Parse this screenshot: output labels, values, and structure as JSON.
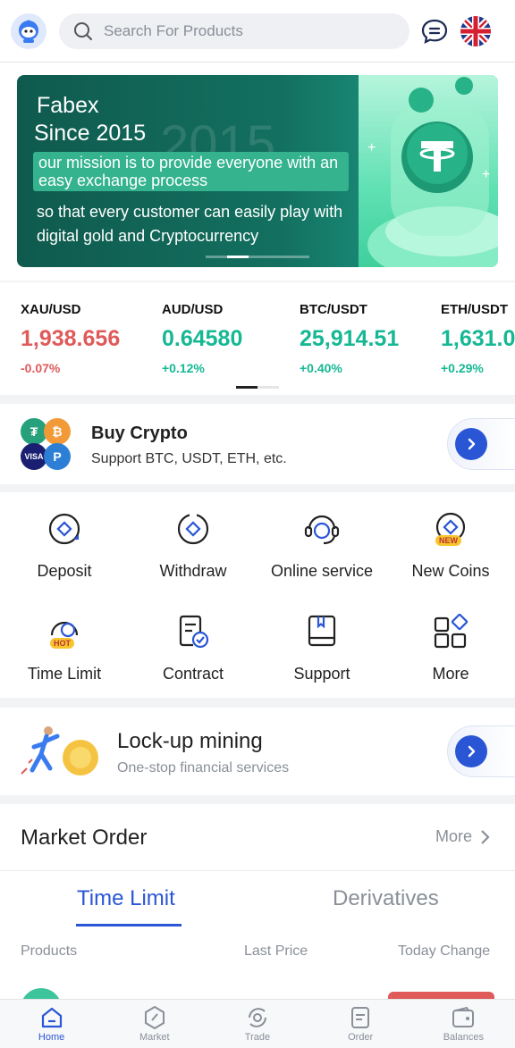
{
  "header": {
    "search_placeholder": "Search For Products"
  },
  "banner": {
    "title_line1": "Fabex",
    "title_line2": "Since 2015",
    "bg_year": "2015",
    "mission": "our mission is to provide everyone with an easy exchange process",
    "description": "so that every customer can easily play with digital gold and Cryptocurrency"
  },
  "ticker": [
    {
      "pair": "XAU/USD",
      "price": "1,938.656",
      "change": "-0.07%",
      "trend": "down"
    },
    {
      "pair": "AUD/USD",
      "price": "0.64580",
      "change": "+0.12%",
      "trend": "up"
    },
    {
      "pair": "BTC/USDT",
      "price": "25,914.51",
      "change": "+0.40%",
      "trend": "up"
    },
    {
      "pair": "ETH/USDT",
      "price": "1,631.0",
      "change": "+0.29%",
      "trend": "up"
    }
  ],
  "buy": {
    "title": "Buy Crypto",
    "subtitle": "Support BTC, USDT, ETH, etc.",
    "visa_label": "VISA"
  },
  "grid": [
    {
      "label": "Deposit"
    },
    {
      "label": "Withdraw"
    },
    {
      "label": "Online service"
    },
    {
      "label": "New Coins",
      "badge": "NEW"
    },
    {
      "label": "Time Limit",
      "badge": "HOT"
    },
    {
      "label": "Contract"
    },
    {
      "label": "Support"
    },
    {
      "label": "More"
    }
  ],
  "lock": {
    "title": "Lock-up mining",
    "subtitle": "One-stop financial services"
  },
  "market": {
    "title": "Market Order",
    "more": "More",
    "tabs": [
      "Time Limit",
      "Derivatives"
    ],
    "columns": [
      "Products",
      "Last Price",
      "Today Change"
    ]
  },
  "nav": [
    {
      "label": "Home"
    },
    {
      "label": "Market"
    },
    {
      "label": "Trade"
    },
    {
      "label": "Order"
    },
    {
      "label": "Balances"
    }
  ],
  "colors": {
    "accent": "#2a56d6",
    "up": "#16b894",
    "down": "#e05a5a"
  }
}
